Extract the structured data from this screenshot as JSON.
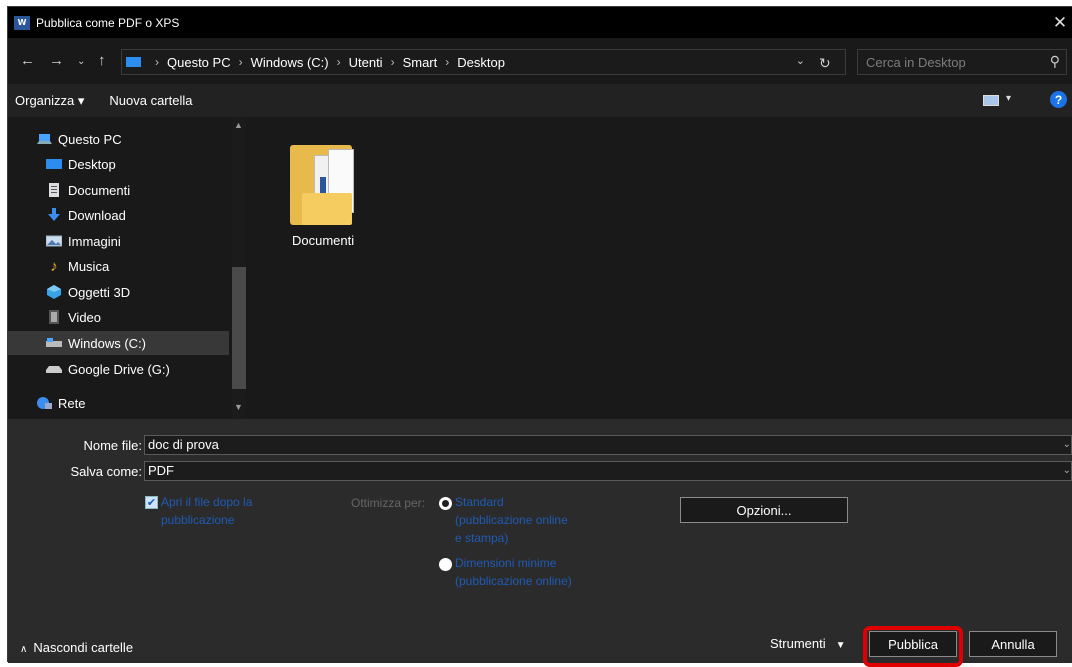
{
  "window": {
    "title": "Pubblica come PDF o XPS",
    "app_icon_text": "W"
  },
  "address": {
    "breadcrumbs": [
      "Questo PC",
      "Windows (C:)",
      "Utenti",
      "Smart",
      "Desktop"
    ],
    "search_placeholder": "Cerca in Desktop"
  },
  "toolbar": {
    "organize": "Organizza ▾",
    "new_folder": "Nuova cartella",
    "help": "?"
  },
  "nav": {
    "items": [
      {
        "label": "Questo PC",
        "icon": "computer-icon"
      },
      {
        "label": "Desktop",
        "icon": "desktop-folder-icon"
      },
      {
        "label": "Documenti",
        "icon": "documents-icon"
      },
      {
        "label": "Download",
        "icon": "download-icon"
      },
      {
        "label": "Immagini",
        "icon": "pictures-icon"
      },
      {
        "label": "Musica",
        "icon": "music-icon"
      },
      {
        "label": "Oggetti 3D",
        "icon": "3d-objects-icon"
      },
      {
        "label": "Video",
        "icon": "video-icon"
      },
      {
        "label": "Windows (C:)",
        "icon": "drive-icon",
        "selected": true
      },
      {
        "label": "Google Drive (G:)",
        "icon": "drive-icon"
      },
      {
        "label": "Rete",
        "icon": "network-icon"
      }
    ]
  },
  "content": {
    "files": [
      {
        "name": "Documenti",
        "type": "folder"
      }
    ]
  },
  "form": {
    "filename_label": "Nome file:",
    "filename_value": "doc di prova",
    "saveas_label": "Salva come:",
    "saveas_value": "PDF",
    "open_after_checked": true,
    "open_after_line1": "Apri il file dopo la",
    "open_after_line2": "pubblicazione",
    "optimize_label": "Ottimizza per:",
    "opt_standard_line1": "Standard",
    "opt_standard_line2": "(pubblicazione online",
    "opt_standard_line3": "e stampa)",
    "opt_min_line1": "Dimensioni minime",
    "opt_min_line2": "(pubblicazione online)",
    "options_button": "Opzioni..."
  },
  "footer": {
    "hide_folders": "Nascondi cartelle",
    "tools": "Strumenti",
    "publish": "Pubblica",
    "cancel": "Annulla"
  },
  "colors": {
    "highlight": "#e00000",
    "link_blue": "#1f5bb4",
    "help_blue": "#1a73e8"
  }
}
